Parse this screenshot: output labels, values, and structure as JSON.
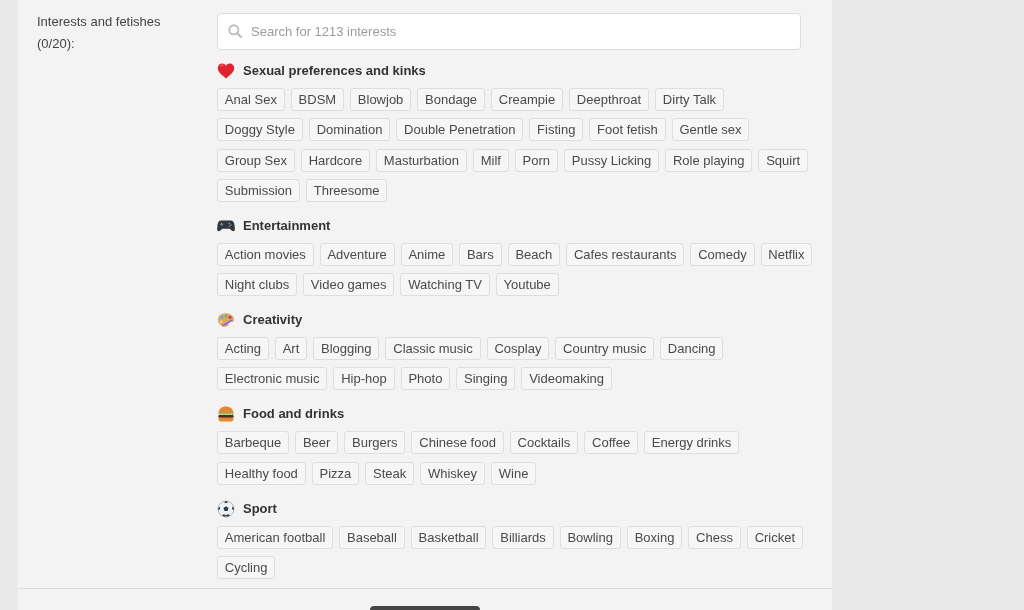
{
  "field": {
    "label": "Interests and fetishes (0/20):"
  },
  "search": {
    "placeholder": "Search for 1213 interests"
  },
  "categories": [
    {
      "title": "Sexual preferences and kinks",
      "tags": [
        {
          "label": "Anal Sex",
          "selected": false
        },
        {
          "label": "BDSM",
          "selected": false
        },
        {
          "label": "Blowjob",
          "selected": false
        },
        {
          "label": "Bondage",
          "selected": false
        },
        {
          "label": "Creampie",
          "selected": false
        },
        {
          "label": "Deepthroat",
          "selected": false
        },
        {
          "label": "Dirty Talk",
          "selected": false
        },
        {
          "label": "Doggy Style",
          "selected": false
        },
        {
          "label": "Domination",
          "selected": false
        },
        {
          "label": "Double Penetration",
          "selected": false
        },
        {
          "label": "Fisting",
          "selected": false
        },
        {
          "label": "Foot fetish",
          "selected": false
        },
        {
          "label": "Gentle sex",
          "selected": false
        },
        {
          "label": "Group Sex",
          "selected": false
        },
        {
          "label": "Hardcore",
          "selected": false
        },
        {
          "label": "Masturbation",
          "selected": false
        },
        {
          "label": "Milf",
          "selected": false
        },
        {
          "label": "Porn",
          "selected": false
        },
        {
          "label": "Pussy Licking",
          "selected": false
        },
        {
          "label": "Role playing",
          "selected": false
        },
        {
          "label": "Squirt",
          "selected": false
        },
        {
          "label": "Submission",
          "selected": false
        },
        {
          "label": "Threesome",
          "selected": false
        }
      ]
    },
    {
      "title": "Entertainment",
      "tags": [
        {
          "label": "Action movies",
          "selected": false
        },
        {
          "label": "Adventure",
          "selected": false
        },
        {
          "label": "Anime",
          "selected": false
        },
        {
          "label": "Bars",
          "selected": false
        },
        {
          "label": "Beach",
          "selected": false
        },
        {
          "label": "Cafes restaurants",
          "selected": false
        },
        {
          "label": "Comedy",
          "selected": false
        },
        {
          "label": "Netflix",
          "selected": false
        },
        {
          "label": "Night clubs",
          "selected": false
        },
        {
          "label": "Video games",
          "selected": false
        },
        {
          "label": "Watching TV",
          "selected": false
        },
        {
          "label": "Youtube",
          "selected": false
        }
      ]
    },
    {
      "title": "Creativity",
      "tags": [
        {
          "label": "Acting",
          "selected": false
        },
        {
          "label": "Art",
          "selected": false
        },
        {
          "label": "Blogging",
          "selected": false
        },
        {
          "label": "Classic music",
          "selected": false
        },
        {
          "label": "Cosplay",
          "selected": false
        },
        {
          "label": "Country music",
          "selected": false
        },
        {
          "label": "Dancing",
          "selected": false
        },
        {
          "label": "Electronic music",
          "selected": false
        },
        {
          "label": "Hip-hop",
          "selected": false
        },
        {
          "label": "Photo",
          "selected": false
        },
        {
          "label": "Singing",
          "selected": false
        },
        {
          "label": "Videomaking",
          "selected": false
        }
      ]
    },
    {
      "title": "Food and drinks",
      "tags": [
        {
          "label": "Barbeque",
          "selected": false
        },
        {
          "label": "Beer",
          "selected": false
        },
        {
          "label": "Burgers",
          "selected": false
        },
        {
          "label": "Chinese food",
          "selected": false
        },
        {
          "label": "Cocktails",
          "selected": false
        },
        {
          "label": "Coffee",
          "selected": false
        },
        {
          "label": "Energy drinks",
          "selected": false
        },
        {
          "label": "Healthy food",
          "selected": false
        },
        {
          "label": "Pizza",
          "selected": false
        },
        {
          "label": "Steak",
          "selected": false
        },
        {
          "label": "Whiskey",
          "selected": false
        },
        {
          "label": "Wine",
          "selected": false
        }
      ]
    },
    {
      "title": "Sport",
      "tags": [
        {
          "label": "American football",
          "selected": false
        },
        {
          "label": "Baseball",
          "selected": false
        },
        {
          "label": "Basketball",
          "selected": false
        },
        {
          "label": "Billiards",
          "selected": false
        },
        {
          "label": "Bowling",
          "selected": false
        },
        {
          "label": "Boxing",
          "selected": false
        },
        {
          "label": "Chess",
          "selected": false
        },
        {
          "label": "Cricket",
          "selected": false
        },
        {
          "label": "Cycling",
          "selected": false
        }
      ]
    }
  ]
}
